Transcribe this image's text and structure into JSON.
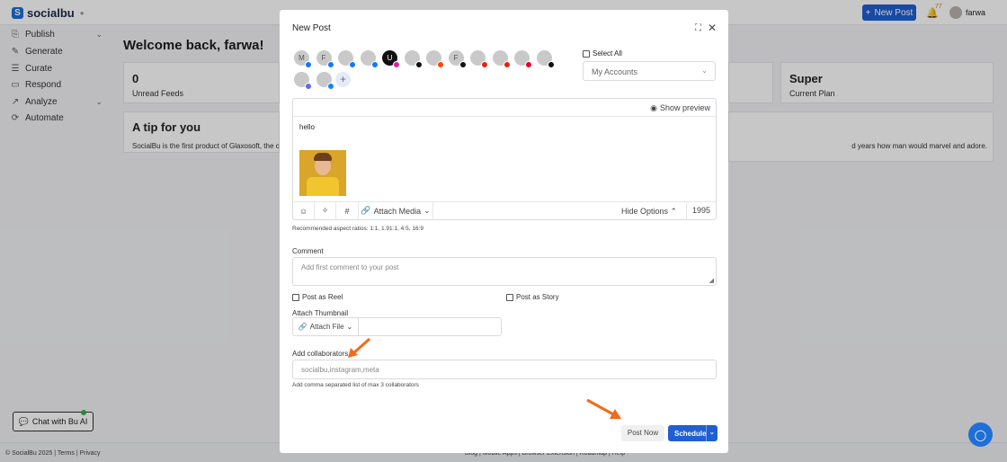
{
  "app": {
    "brand": "socialbu",
    "new_post_label": "New Post",
    "notification_count": "77",
    "user_name": "farwa"
  },
  "sidebar": {
    "items": [
      {
        "label": "Publish",
        "icon": "publish-icon"
      },
      {
        "label": "Generate",
        "icon": "generate-icon"
      },
      {
        "label": "Curate",
        "icon": "curate-icon"
      },
      {
        "label": "Respond",
        "icon": "respond-icon"
      },
      {
        "label": "Analyze",
        "icon": "analyze-icon"
      },
      {
        "label": "Automate",
        "icon": "automate-icon"
      }
    ],
    "chat_label": "Chat with Bu AI"
  },
  "dashboard": {
    "welcome": "Welcome back, farwa!",
    "stats": [
      {
        "value": "0",
        "label": "Unread Feeds"
      },
      {
        "value": "Super",
        "label": "Current Plan"
      }
    ],
    "tip_title": "A tip for you",
    "tip_text_left": "SocialBu is the first product of Glaxosoft, the comp",
    "tip_text_right": "d years how man would marvel and adore."
  },
  "footer": {
    "left": "© SocialBu 2025 | Terms | Privacy",
    "center": "Blog | Mobile Apps | Browser Extension | Roadmap | Help"
  },
  "modal": {
    "title": "New Post",
    "accounts_row1": [
      {
        "initial": "M",
        "network": "facebook",
        "net_color": "#1877f2"
      },
      {
        "initial": "F",
        "network": "facebook",
        "net_color": "#1877f2"
      },
      {
        "initial": "",
        "network": "facebook",
        "net_color": "#1877f2"
      },
      {
        "initial": "",
        "network": "facebook",
        "net_color": "#1877f2"
      },
      {
        "initial": "U",
        "network": "instagram",
        "net_color": "#d6249f"
      },
      {
        "initial": "",
        "network": "tiktok",
        "net_color": "#111111"
      },
      {
        "initial": "",
        "network": "reddit",
        "net_color": "#ff4500"
      },
      {
        "initial": "F",
        "network": "tiktok",
        "net_color": "#111111"
      },
      {
        "initial": "",
        "network": "youtube",
        "net_color": "#e62117"
      },
      {
        "initial": "",
        "network": "youtube",
        "net_color": "#e62117"
      },
      {
        "initial": "",
        "network": "pinterest",
        "net_color": "#e60023"
      },
      {
        "initial": "",
        "network": "threads",
        "net_color": "#111111"
      }
    ],
    "accounts_row2": [
      {
        "initial": "",
        "network": "mastodon",
        "net_color": "#6364ff"
      },
      {
        "initial": "",
        "network": "bluesky",
        "net_color": "#1185fe"
      }
    ],
    "select_all": "Select All",
    "my_accounts": "My Accounts",
    "show_preview": "Show preview",
    "post_text": "hello",
    "attach_media": "Attach Media",
    "hide_options": "Hide Options",
    "char_count": "1995",
    "aspect_ratios": "Recommended aspect ratios: 1:1, 1.91:1, 4:5, 16:9",
    "comment_label": "Comment",
    "comment_placeholder": "Add first comment to your post",
    "post_as_reel": "Post as Reel",
    "post_as_story": "Post as Story",
    "attach_thumbnail": "Attach Thumbnail",
    "attach_file": "Attach File",
    "collaborators_label": "Add collaborators",
    "collaborators_placeholder": "socialbu,instagram,meta",
    "collaborators_hint": "Add comma separated list of max 3 collaborators",
    "post_now": "Post Now",
    "schedule": "Schedule"
  },
  "colors": {
    "primary": "#1f5fd1",
    "annotation_arrow": "#f26a1b"
  }
}
